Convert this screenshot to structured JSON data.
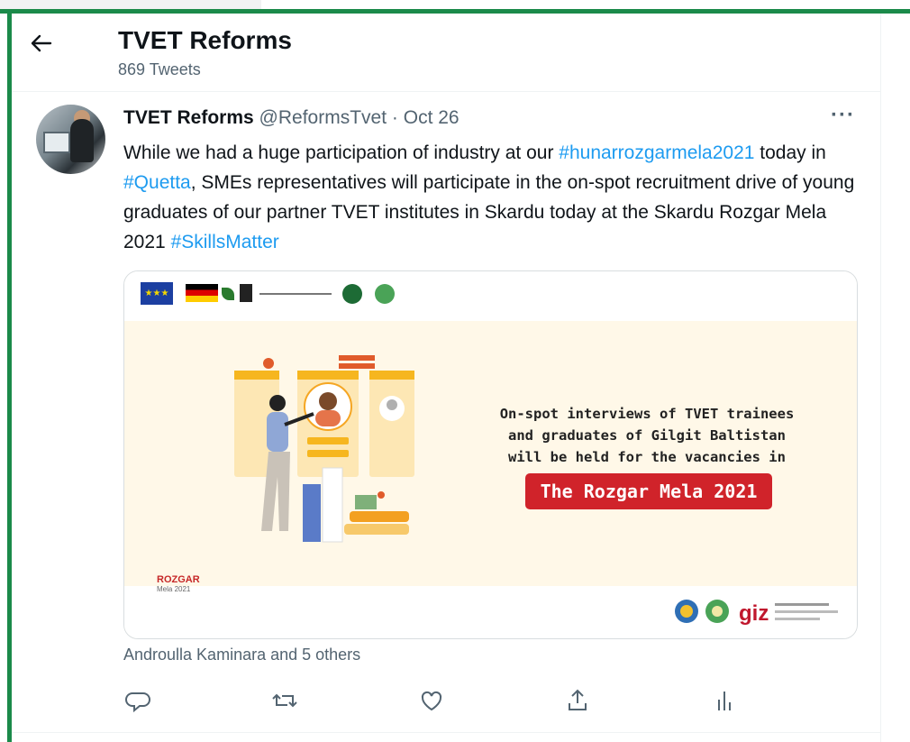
{
  "header": {
    "title": "TVET Reforms",
    "tweet_count": "869 Tweets"
  },
  "tweet": {
    "author_name": "TVET Reforms",
    "handle": "@ReformsTvet",
    "separator": "·",
    "date": "Oct 26",
    "text_parts": {
      "p1": "While we had a huge participation of industry at our ",
      "tag1": "#hunarrozgarmela2021",
      "p2": " today in ",
      "tag2": "#Quetta",
      "p3": ", SMEs representatives will participate in the on-spot recruitment drive of young graduates of our partner TVET institutes in Skardu today at the Skardu Rozgar Mela 2021 ",
      "tag3": "#SkillsMatter"
    },
    "card": {
      "message_line1": "On-spot interviews of TVET trainees",
      "message_line2": "and graduates of Gilgit Baltistan",
      "message_line3": "will be held for the vacancies in",
      "badge": "The Rozgar Mela 2021",
      "rozgar_logo": "ROZGAR",
      "rozgar_logo_sub": "Mela 2021",
      "giz_logo": "giz"
    },
    "social_context": "Androulla Kaminara and 5 others",
    "actions": [
      "reply-icon",
      "retweet-icon",
      "like-icon",
      "share-icon",
      "analytics-icon"
    ]
  },
  "colors": {
    "frame": "#1b8a4a",
    "link": "#1d9bf0",
    "badge": "#d0232a",
    "card_bg": "#fff8e8"
  }
}
